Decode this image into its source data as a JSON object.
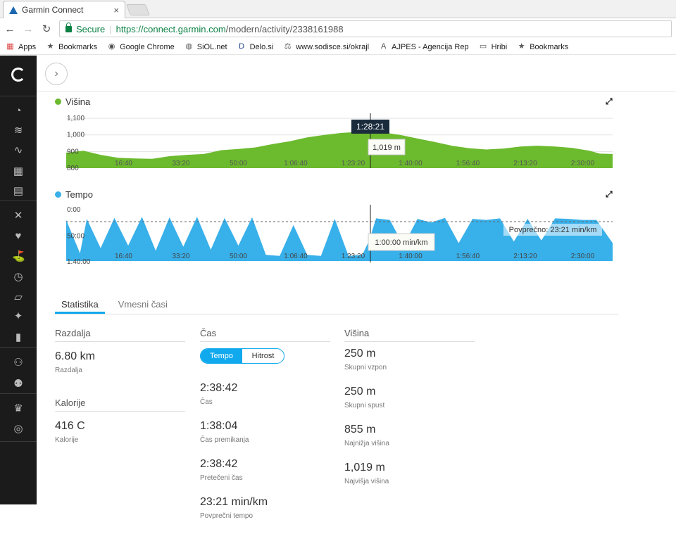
{
  "browser": {
    "tab_title": "Garmin Connect",
    "tab_close": "×",
    "secure_label": "Secure",
    "url_host": "https://connect.garmin.com",
    "url_path": "/modern/activity/2338161988",
    "bookmarks": [
      {
        "label": "Apps",
        "icon": "apps-icon"
      },
      {
        "label": "Bookmarks",
        "icon": "star-icon"
      },
      {
        "label": "Google Chrome",
        "icon": "chrome-icon"
      },
      {
        "label": "SiOL.net",
        "icon": "siol-icon"
      },
      {
        "label": "Delo.si",
        "icon": "delo-icon"
      },
      {
        "label": "www.sodisce.si/okrajl",
        "icon": "scales-icon"
      },
      {
        "label": "AJPES - Agencija Rep",
        "icon": "ajpes-icon"
      },
      {
        "label": "Hribi",
        "icon": "hribi-icon"
      },
      {
        "label": "Bookmarks",
        "icon": "star-icon"
      }
    ]
  },
  "sidebar": {
    "icons": [
      "dashboard-icon",
      "layers-icon",
      "activity-icon",
      "calendar-icon",
      "news-icon",
      "fitness-icon",
      "heart-icon",
      "golf-icon",
      "stopwatch-icon",
      "shoe-icon",
      "lightbulb-icon",
      "bar-chart-icon",
      "connections-icon",
      "groups-icon",
      "trophy-icon",
      "target-icon"
    ]
  },
  "colors": {
    "altitude": "#6cba2e",
    "pace": "#38b0ea",
    "accent": "#11a9ed",
    "tooltip": "#1a2b3c"
  },
  "chart_data": [
    {
      "type": "area",
      "title": "Višina",
      "yticks": [
        "1,100",
        "1,000",
        "900",
        "800"
      ],
      "xticks": [
        "16:40",
        "33:20",
        "50:00",
        "1:06:40",
        "1:23:20",
        "1:40:00",
        "1:56:40",
        "2:13:20",
        "2:30:00"
      ],
      "ylim": [
        800,
        1130
      ],
      "xlim_minutes": [
        0,
        158.7
      ],
      "x_minutes": [
        0,
        5,
        10,
        15,
        20,
        25,
        30,
        35,
        40,
        45,
        50,
        55,
        60,
        65,
        70,
        75,
        80,
        85,
        88.35,
        92,
        97,
        102,
        107,
        112,
        117,
        122,
        127,
        132,
        137,
        142,
        147,
        152,
        155,
        158.7
      ],
      "y": [
        893,
        905,
        880,
        862,
        858,
        856,
        872,
        880,
        885,
        908,
        915,
        925,
        945,
        962,
        985,
        1000,
        1012,
        1018,
        1019,
        1015,
        1000,
        978,
        958,
        935,
        920,
        912,
        918,
        930,
        935,
        930,
        922,
        905,
        887,
        885
      ],
      "cursor_time": "1:28:21",
      "cursor_value": "1,019 m"
    },
    {
      "type": "area",
      "title": "Tempo",
      "yticks": [
        "0:00",
        "50:00",
        "1:40:00"
      ],
      "xticks": [
        "16:40",
        "33:20",
        "50:00",
        "1:06:40",
        "1:23:20",
        "1:40:00",
        "1:56:40",
        "2:13:20",
        "2:30:00"
      ],
      "ylim_minutes": [
        0,
        100
      ],
      "xlim_minutes": [
        0,
        158.7
      ],
      "x_minutes": [
        0,
        4,
        6,
        10,
        14,
        18,
        22,
        26,
        30,
        34,
        38,
        42,
        46,
        50,
        54,
        58,
        62,
        66,
        70,
        74,
        78,
        82,
        86,
        88,
        90,
        94,
        98,
        102,
        106,
        110,
        114,
        118,
        122,
        126,
        130,
        134,
        138,
        142,
        146,
        150,
        154,
        158.7
      ],
      "y": [
        20,
        85,
        18,
        75,
        16,
        70,
        14,
        80,
        15,
        72,
        14,
        78,
        16,
        70,
        15,
        88,
        90,
        30,
        88,
        90,
        18,
        90,
        88,
        60,
        17,
        20,
        70,
        18,
        25,
        16,
        65,
        18,
        20,
        17,
        62,
        18,
        60,
        17,
        18,
        20,
        20,
        65
      ],
      "average_label": "Povprečno: 23:21 min/km",
      "average_minutes": 23.35,
      "cursor_value": "1:00:00 min/km"
    }
  ],
  "tabs": [
    "Statistika",
    "Vmesni časi"
  ],
  "stats": {
    "distance": {
      "head": "Razdalja",
      "value": "6.80 km",
      "label": "Razdalja"
    },
    "calories": {
      "head": "Kalorije",
      "value": "416 C",
      "label": "Kalorije"
    },
    "time": {
      "head": "Čas",
      "toggle": [
        "Tempo",
        "Hitrost"
      ],
      "items": [
        {
          "value": "2:38:42",
          "label": "Čas"
        },
        {
          "value": "1:38:04",
          "label": "Čas premikanja"
        },
        {
          "value": "2:38:42",
          "label": "Pretečeni čas"
        },
        {
          "value": "23:21 min/km",
          "label": "Povprečni tempo"
        }
      ]
    },
    "elevation": {
      "head": "Višina",
      "items": [
        {
          "value": "250 m",
          "label": "Skupni vzpon"
        },
        {
          "value": "250 m",
          "label": "Skupni spust"
        },
        {
          "value": "855 m",
          "label": "Najnižja višina"
        },
        {
          "value": "1,019 m",
          "label": "Najvišja višina"
        }
      ]
    }
  }
}
